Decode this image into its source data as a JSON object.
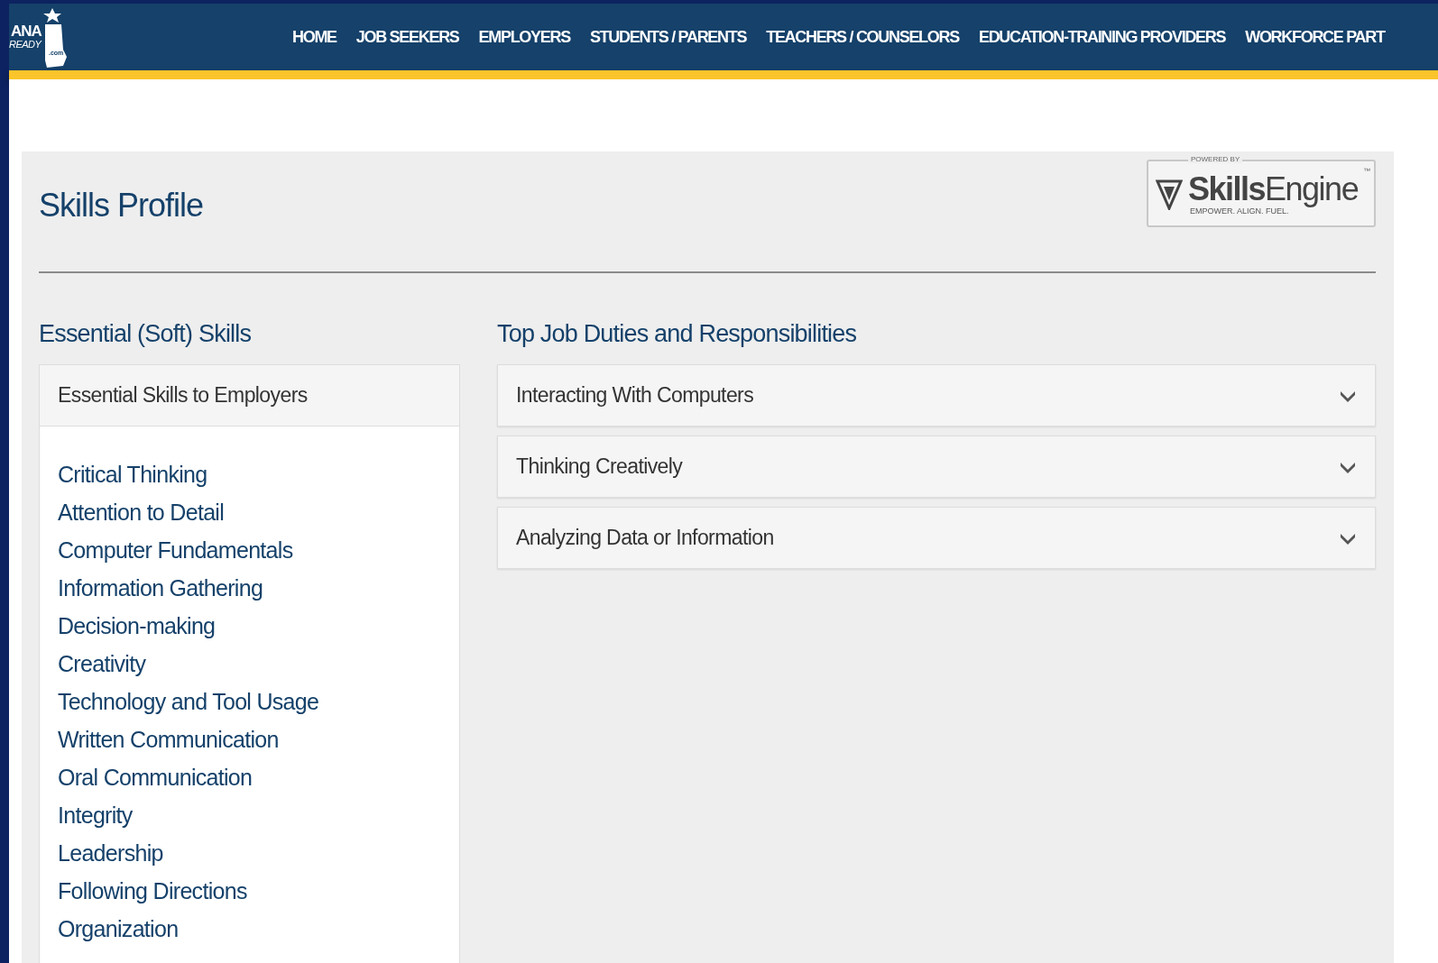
{
  "header": {
    "logo": {
      "line_1": "ANA",
      "line_2": "READY",
      ".com": ".com"
    },
    "nav": [
      {
        "label": "HOME"
      },
      {
        "label": "JOB SEEKERS"
      },
      {
        "label": "EMPLOYERS"
      },
      {
        "label": "STUDENTS / PARENTS"
      },
      {
        "label": "TEACHERS / COUNSELORS"
      },
      {
        "label": "EDUCATION-TRAINING PROVIDERS"
      },
      {
        "label": "WORKFORCE PART"
      }
    ]
  },
  "profile": {
    "title": "Skills Profile",
    "badge": {
      "top": "POWERED BY",
      "name": "**Skills**Engine",
      "mark": "™",
      "tagline": "EMPOWER. ALIGN. FUEL."
    }
  },
  "essential": {
    "heading": "Essential (Soft) Skills",
    "card_title": "Essential Skills to Employers",
    "skills": [
      "Critical Thinking",
      "Attention to Detail",
      "Computer Fundamentals",
      "Information Gathering",
      "Decision-making",
      "Creativity",
      "Technology and Tool Usage",
      "Written Communication",
      "Oral Communication",
      "Integrity",
      "Leadership",
      "Following Directions",
      "Organization"
    ]
  },
  "duties": {
    "heading": "Top Job Duties and Responsibilities",
    "items": [
      {
        "label": "Interacting With Computers",
        "expanded": false
      },
      {
        "label": "Thinking Creatively",
        "expanded": false
      },
      {
        "label": "Analyzing Data or Information",
        "expanded": false
      }
    ]
  }
}
